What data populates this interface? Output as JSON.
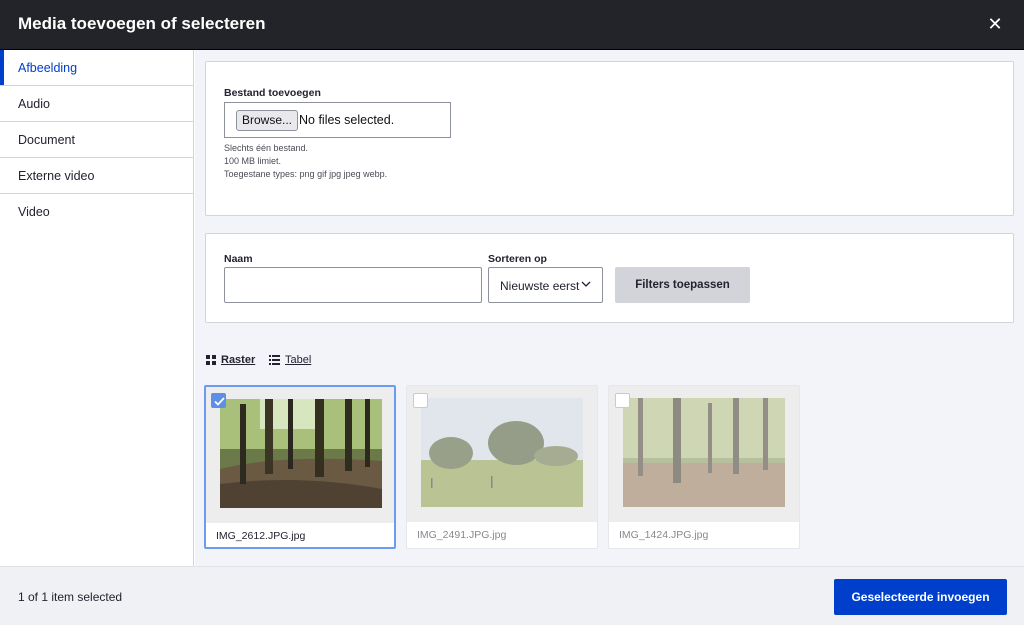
{
  "dialog": {
    "title": "Media toevoegen of selecteren",
    "close_icon": "close-icon"
  },
  "sidebar": {
    "items": [
      {
        "label": "Afbeelding",
        "active": true
      },
      {
        "label": "Audio",
        "active": false
      },
      {
        "label": "Document",
        "active": false
      },
      {
        "label": "Externe video",
        "active": false
      },
      {
        "label": "Video",
        "active": false
      }
    ]
  },
  "upload": {
    "label": "Bestand toevoegen",
    "browse_label": "Browse...",
    "file_status": "No files selected.",
    "help": [
      "Slechts één bestand.",
      "100 MB limiet.",
      "Toegestane types: png gif jpg jpeg webp."
    ]
  },
  "filters": {
    "name_label": "Naam",
    "name_value": "",
    "sort_label": "Sorteren op",
    "sort_value": "Nieuwste eerst",
    "apply_label": "Filters toepassen"
  },
  "view": {
    "grid_label": "Raster",
    "table_label": "Tabel",
    "grid_icon": "grid-icon",
    "table_icon": "list-icon"
  },
  "media": [
    {
      "name": "IMG_2612.JPG.jpg",
      "selected": true
    },
    {
      "name": "IMG_2491.JPG.jpg",
      "selected": false
    },
    {
      "name": "IMG_1424.JPG.jpg",
      "selected": false
    }
  ],
  "footer": {
    "status": "1 of 1 item selected",
    "insert_label": "Geselecteerde invoegen"
  },
  "colors": {
    "accent": "#003ecc",
    "titlebar": "#232429",
    "selection": "#5e8fe8"
  }
}
